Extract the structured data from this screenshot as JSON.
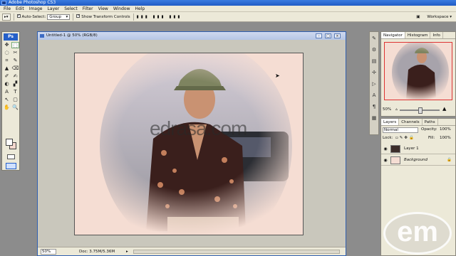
{
  "app": {
    "title": "Adobe Photoshop CS3"
  },
  "menu": [
    "File",
    "Edit",
    "Image",
    "Layer",
    "Select",
    "Filter",
    "View",
    "Window",
    "Help"
  ],
  "options": {
    "auto_select_label": "Auto-Select:",
    "auto_select_value": "Group",
    "show_transform_label": "Show Transform Controls",
    "workspace_label": "Workspace ▾"
  },
  "toolbox": {
    "logo": "Ps",
    "tools": [
      "✥",
      "⬚",
      "◌",
      "✂",
      "⌗",
      "✎",
      "▲",
      "⌫",
      "✐",
      "✍",
      "◐",
      "▞",
      "A",
      "T",
      "↖",
      "▢",
      "✋",
      "🔍"
    ]
  },
  "document": {
    "title": "Untitled-1 @ 50% (RGB/8)",
    "zoom": "50%",
    "doc_info": "Doc: 3.75M/5.36M"
  },
  "navigator": {
    "tabs": [
      "Navigator",
      "Histogram",
      "Info"
    ],
    "zoom": "50%"
  },
  "layers": {
    "tabs": [
      "Layers",
      "Channels",
      "Paths"
    ],
    "blend_mode": "Normal",
    "opacity_label": "Opacity:",
    "opacity_value": "100%",
    "lock_label": "Lock:",
    "fill_label": "Fill:",
    "fill_value": "100%",
    "items": [
      {
        "name": "Layer 1"
      },
      {
        "name": "Background"
      }
    ]
  },
  "watermark": {
    "site": "edrasa.com",
    "logo": "em"
  },
  "colors": {
    "canvas_bg": "#f5ddd3",
    "title_blue": "#1f5bc4",
    "panel": "#ece9d8"
  }
}
